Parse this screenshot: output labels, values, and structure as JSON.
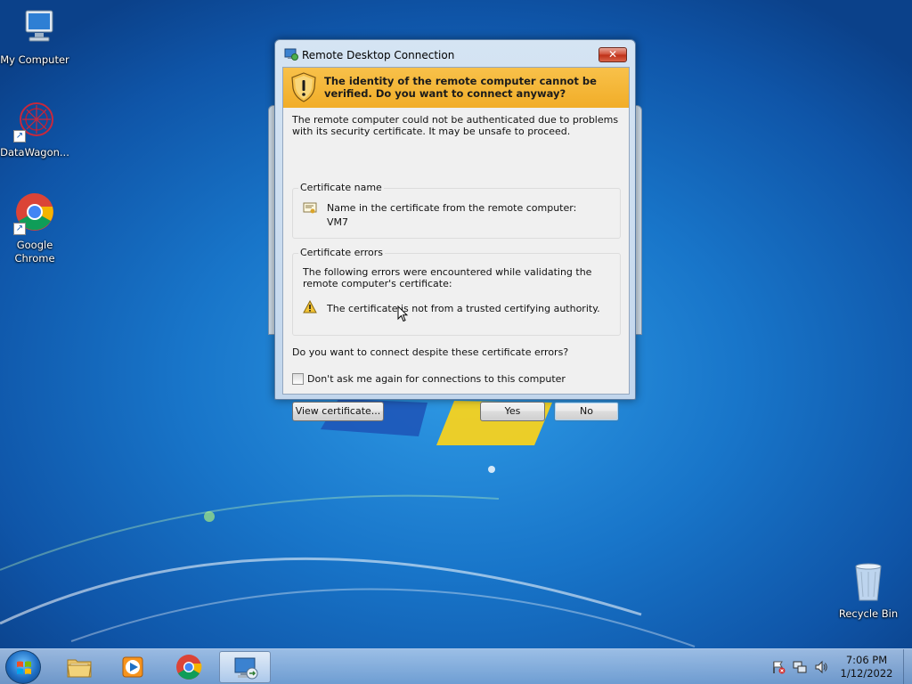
{
  "desktop": {
    "icons": [
      {
        "label": "My Computer",
        "icon": "computer-icon"
      },
      {
        "label": "DataWagon...",
        "icon": "datawagon-icon"
      },
      {
        "label": "Google Chrome",
        "icon": "chrome-icon"
      },
      {
        "label": "Recycle Bin",
        "icon": "recycle-bin-icon"
      }
    ]
  },
  "dialog": {
    "title": "Remote Desktop Connection",
    "close_label": "✕",
    "warning_heading": "The identity of the remote computer cannot be verified. Do you want to connect anyway?",
    "intro": "The remote computer could not be authenticated due to problems with its security certificate. It may be unsafe to proceed.",
    "cert_name_group": {
      "label": "Certificate name",
      "line1": "Name in the certificate from the remote computer:",
      "line2": "VM7"
    },
    "cert_errors_group": {
      "label": "Certificate errors",
      "intro": "The following errors were encountered while validating the remote computer's certificate:",
      "error": "The certificate is not from a trusted certifying authority."
    },
    "question": "Do you want to connect despite these certificate errors?",
    "checkbox_label": "Don't ask me again for connections to this computer",
    "checkbox_checked": false,
    "buttons": {
      "view_certificate": "View certificate...",
      "yes": "Yes",
      "no": "No"
    }
  },
  "taskbar": {
    "items": [
      {
        "name": "file-explorer",
        "icon": "folder-icon"
      },
      {
        "name": "media-player",
        "icon": "media-player-icon"
      },
      {
        "name": "chrome",
        "icon": "chrome-icon"
      },
      {
        "name": "remote-desktop",
        "icon": "remote-desktop-icon",
        "active": true
      }
    ],
    "clock": {
      "time": "7:06 PM",
      "date": "1/12/2022"
    }
  },
  "colors": {
    "warning_banner": "#f1ad28",
    "desktop_blue": "#1875c9",
    "close_button": "#cf4b33"
  }
}
